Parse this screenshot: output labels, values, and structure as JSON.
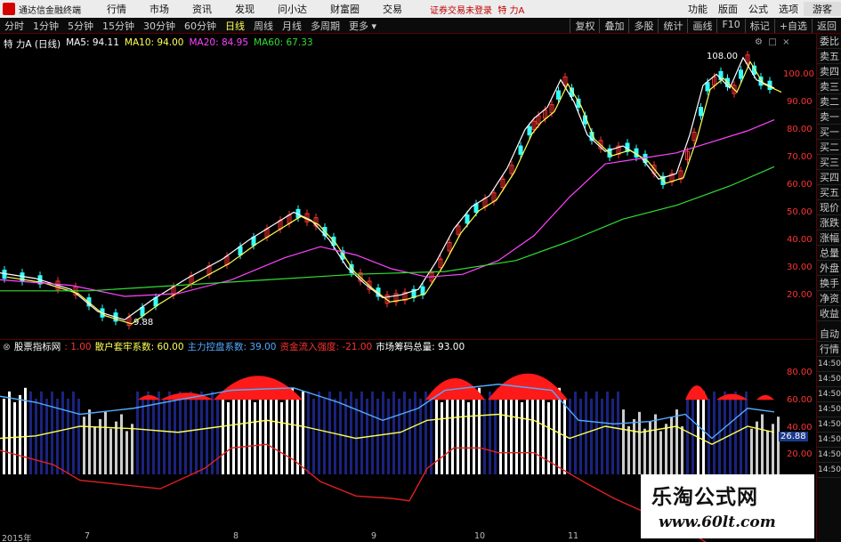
{
  "titlebar": {
    "app_name": "通达信金融终端",
    "menu": [
      "行情",
      "市场",
      "资讯",
      "发现",
      "问小达",
      "财富圈",
      "交易"
    ],
    "trade_status": "证券交易未登录",
    "stock_name": "特 力A",
    "right_menu": [
      "功能",
      "版面",
      "公式",
      "选项"
    ],
    "guest": "游客"
  },
  "toolbar": {
    "periods": [
      "分时",
      "1分钟",
      "5分钟",
      "15分钟",
      "30分钟",
      "60分钟",
      "日线",
      "周线",
      "月线",
      "多周期",
      "更多"
    ],
    "active_period": "日线",
    "right_buttons": [
      "复权",
      "叠加",
      "多股",
      "统计",
      "画线",
      "F10",
      "标记",
      "+自选",
      "返回"
    ]
  },
  "ma_legend": {
    "name": "特 力A (日线)",
    "ma5": "MA5: 94.11",
    "ma10": "MA10: 94.00",
    "ma20": "MA20: 84.95",
    "ma60": "MA60: 67.33"
  },
  "price_axis": [
    "100.00",
    "90.00",
    "80.00",
    "70.00",
    "60.00",
    "50.00",
    "40.00",
    "30.00",
    "20.00"
  ],
  "price_annotations": {
    "high": "108.00",
    "low": "9.88"
  },
  "indicator": {
    "name": "股票指标网",
    "items": [
      {
        "text": ": 1.00",
        "color": "#ff3333"
      },
      {
        "text": "散户套牢系数: 60.00",
        "color": "#ffff55"
      },
      {
        "text": "主力控盘系数: 39.00",
        "color": "#55aaff"
      },
      {
        "text": "资金流入强度: -21.00",
        "color": "#ff3333"
      },
      {
        "text": "市场筹码总量: 93.00",
        "color": "#ffffff"
      }
    ],
    "axis": [
      "80.00",
      "60.00",
      "40.00",
      "20.00"
    ],
    "current_value": "26.88"
  },
  "right_panel": {
    "tabs": [
      "委比",
      "卖五",
      "卖四",
      "卖三",
      "卖二",
      "卖一",
      "买一",
      "买二",
      "买三",
      "买四",
      "买五",
      "现价",
      "涨跌",
      "涨幅",
      "总量",
      "外盘",
      "换手",
      "净资",
      "收益",
      "自动",
      "行情",
      "14:50",
      "14:50",
      "14:50",
      "14:50",
      "14:50",
      "14:50",
      "14:50",
      "14:50"
    ]
  },
  "dates": [
    "2015年",
    "7",
    "8",
    "9",
    "10",
    "11"
  ],
  "watermark": {
    "title": "乐淘公式网",
    "url": "www.60lt.com"
  },
  "colors": {
    "up": "#ff3333",
    "down": "#33ffff",
    "ma5": "#ffffff",
    "ma10": "#ffff55",
    "ma20": "#ff44ff",
    "ma60": "#33dd33"
  }
}
